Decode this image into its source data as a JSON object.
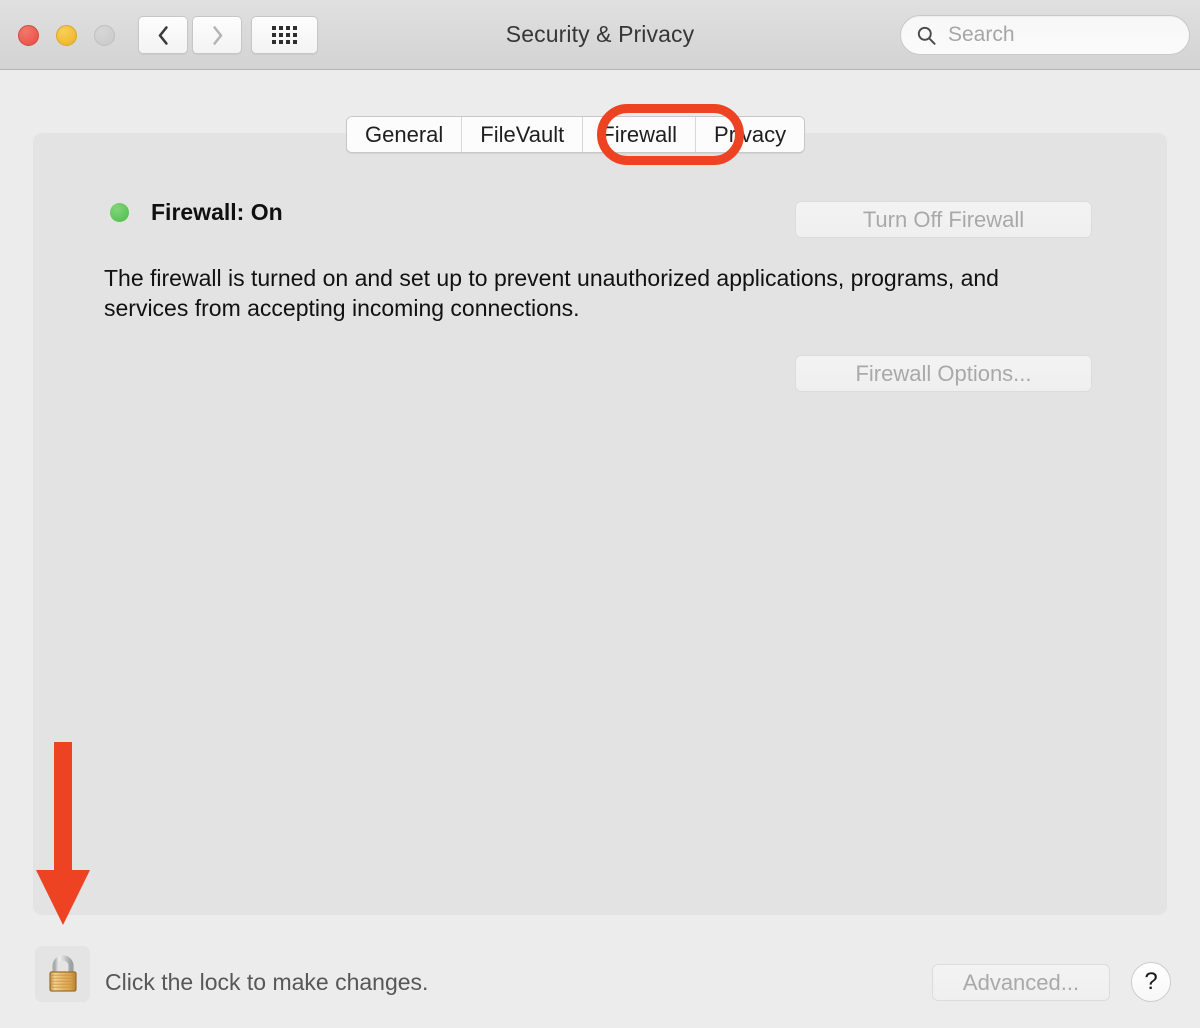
{
  "window": {
    "title": "Security & Privacy",
    "traffic_lights": [
      {
        "name": "close",
        "color": "#ec5f55"
      },
      {
        "name": "minimize",
        "color": "#f2bf38"
      },
      {
        "name": "zoom",
        "color": "#cfcfcf"
      }
    ],
    "nav": {
      "back_label": "Back",
      "forward_label": "Forward",
      "show_all_label": "Show All"
    },
    "search": {
      "placeholder": "Search",
      "value": ""
    }
  },
  "tabs": [
    {
      "label": "General",
      "selected": false
    },
    {
      "label": "FileVault",
      "selected": false
    },
    {
      "label": "Firewall",
      "selected": true
    },
    {
      "label": "Privacy",
      "selected": false
    }
  ],
  "annotations": {
    "highlight_color": "#ee4323",
    "oval_target": "Firewall",
    "arrow_target": "lock-button"
  },
  "firewall": {
    "status_label": "Firewall: On",
    "status_color": "#60c65b",
    "description": "The firewall is turned on and set up to prevent unauthorized applications, programs, and services from accepting incoming connections.",
    "turn_off_button": "Turn Off Firewall",
    "options_button": "Firewall Options...",
    "turn_off_enabled": false,
    "options_enabled": false
  },
  "footer": {
    "lock_caption": "Click the lock to make changes.",
    "lock_state": "locked",
    "advanced_button": "Advanced...",
    "advanced_enabled": false,
    "help_button": "?"
  }
}
